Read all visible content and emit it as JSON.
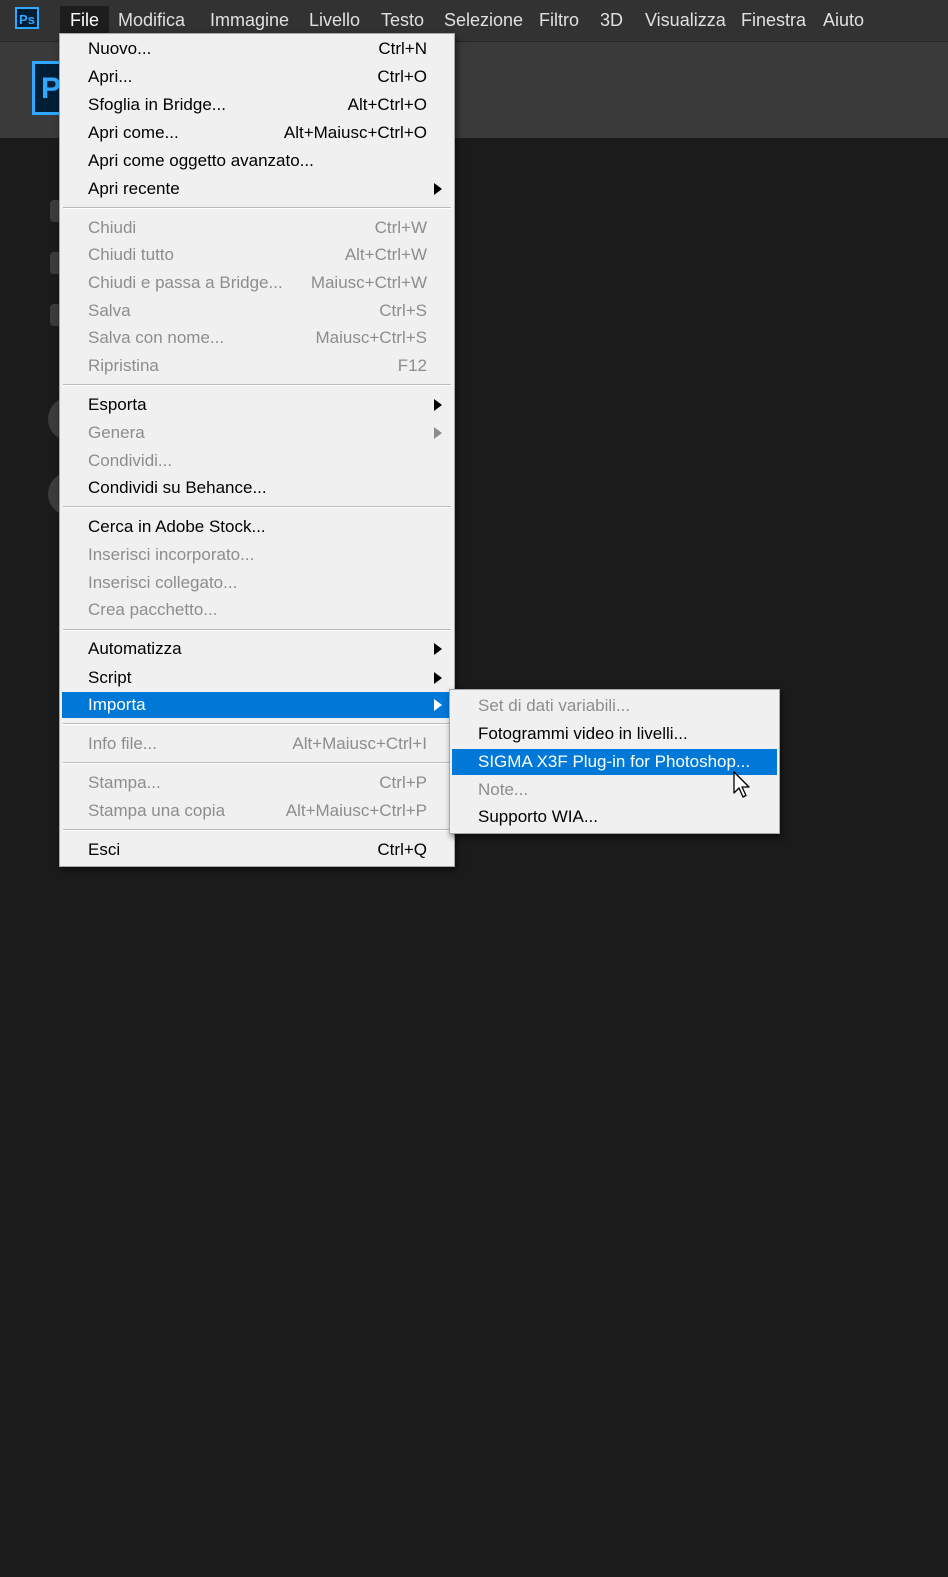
{
  "app": {
    "logo_text": "Ps",
    "brand_color": "#31a8ff",
    "highlight_color": "#0078d7"
  },
  "menubar": {
    "items": [
      "File",
      "Modifica",
      "Immagine",
      "Livello",
      "Testo",
      "Selezione",
      "Filtro",
      "3D",
      "Visualizza",
      "Finestra",
      "Aiuto"
    ],
    "active": "File"
  },
  "home": {
    "logo_letter": "P"
  },
  "file_menu": {
    "items": [
      {
        "label": "Nuovo...",
        "shortcut": "Ctrl+N",
        "enabled": true
      },
      {
        "label": "Apri...",
        "shortcut": "Ctrl+O",
        "enabled": true
      },
      {
        "label": "Sfoglia in Bridge...",
        "shortcut": "Alt+Ctrl+O",
        "enabled": true
      },
      {
        "label": "Apri come...",
        "shortcut": "Alt+Maiusc+Ctrl+O",
        "enabled": true
      },
      {
        "label": "Apri come oggetto avanzato...",
        "shortcut": "",
        "enabled": true
      },
      {
        "label": "Apri recente",
        "shortcut": "",
        "enabled": true,
        "submenu": true
      },
      {
        "label": "Chiudi",
        "shortcut": "Ctrl+W",
        "enabled": false
      },
      {
        "label": "Chiudi tutto",
        "shortcut": "Alt+Ctrl+W",
        "enabled": false
      },
      {
        "label": "Chiudi e passa a Bridge...",
        "shortcut": "Maiusc+Ctrl+W",
        "enabled": false
      },
      {
        "label": "Salva",
        "shortcut": "Ctrl+S",
        "enabled": false
      },
      {
        "label": "Salva con nome...",
        "shortcut": "Maiusc+Ctrl+S",
        "enabled": false
      },
      {
        "label": "Ripristina",
        "shortcut": "F12",
        "enabled": false
      },
      {
        "label": "Esporta",
        "shortcut": "",
        "enabled": true,
        "submenu": true
      },
      {
        "label": "Genera",
        "shortcut": "",
        "enabled": false,
        "submenu": true
      },
      {
        "label": "Condividi...",
        "shortcut": "",
        "enabled": false
      },
      {
        "label": "Condividi su Behance...",
        "shortcut": "",
        "enabled": true
      },
      {
        "label": "Cerca in Adobe Stock...",
        "shortcut": "",
        "enabled": true
      },
      {
        "label": "Inserisci incorporato...",
        "shortcut": "",
        "enabled": false
      },
      {
        "label": "Inserisci collegato...",
        "shortcut": "",
        "enabled": false
      },
      {
        "label": "Crea pacchetto...",
        "shortcut": "",
        "enabled": false
      },
      {
        "label": "Automatizza",
        "shortcut": "",
        "enabled": true,
        "submenu": true
      },
      {
        "label": "Script",
        "shortcut": "",
        "enabled": true,
        "submenu": true
      },
      {
        "label": "Importa",
        "shortcut": "",
        "enabled": true,
        "submenu": true,
        "highlighted": true
      },
      {
        "label": "Info file...",
        "shortcut": "Alt+Maiusc+Ctrl+I",
        "enabled": false
      },
      {
        "label": "Stampa...",
        "shortcut": "Ctrl+P",
        "enabled": false
      },
      {
        "label": "Stampa una copia",
        "shortcut": "Alt+Maiusc+Ctrl+P",
        "enabled": false
      },
      {
        "label": "Esci",
        "shortcut": "Ctrl+Q",
        "enabled": true
      }
    ]
  },
  "import_submenu": {
    "items": [
      {
        "label": "Set di dati variabili...",
        "enabled": false
      },
      {
        "label": "Fotogrammi video in livelli...",
        "enabled": true
      },
      {
        "label": "SIGMA X3F Plug-in for Photoshop...",
        "enabled": true,
        "highlighted": true
      },
      {
        "label": "Note...",
        "enabled": false
      },
      {
        "label": "Supporto WIA...",
        "enabled": true
      }
    ]
  }
}
